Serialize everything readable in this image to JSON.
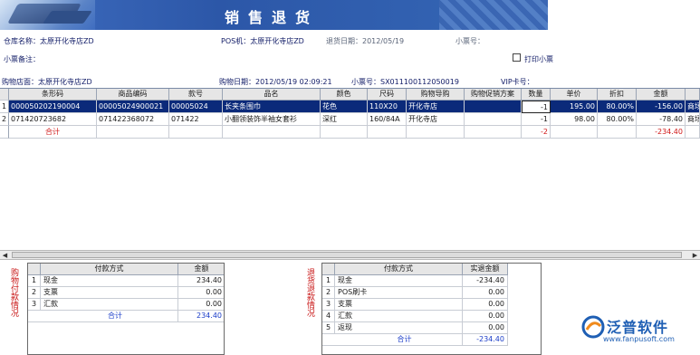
{
  "banner": {
    "title": "销售退货"
  },
  "info": {
    "warehouse": "仓库名称：太原开化寺店ZD",
    "pos": "POS机：太原开化寺店ZD",
    "return_date": "退货日期：2012/05/19",
    "receipt_no_label": "小票号：",
    "remark_label": "小票备注：",
    "print_receipt": "打印小票",
    "shop": "购物店面：太原开化寺店ZD",
    "purchase_date": "购物日期：2012/05/19 02:09:21",
    "receipt_no": "小票号：SX011100112050019",
    "vip_label": "VIP卡号："
  },
  "grid": {
    "columns": [
      "条形码",
      "商品编码",
      "款号",
      "品名",
      "颜色",
      "尺码",
      "购物导购",
      "购物促销方案",
      "数量",
      "单价",
      "折扣",
      "金额"
    ],
    "rows": [
      {
        "no": "1",
        "barcode": "000050202190004",
        "code": "00005024900021",
        "style": "00005024",
        "name": "长夹条围巾",
        "color": "花色",
        "size": "110X20",
        "guide": "开化寺店",
        "promo": "",
        "qty": "-1",
        "price": "195.00",
        "discount": "80.00%",
        "amount": "-156.00",
        "extra": "商场"
      },
      {
        "no": "2",
        "barcode": "071420723682",
        "code": "071422368072",
        "style": "071422",
        "name": "小翻领装饰半袖女套衫",
        "color": "深红",
        "size": "160/84A",
        "guide": "开化寺店",
        "promo": "",
        "qty": "-1",
        "price": "98.00",
        "discount": "80.00%",
        "amount": "-78.40",
        "extra": "商场"
      }
    ],
    "total_label": "合计",
    "total_qty": "-2",
    "total_amount": "-234.40"
  },
  "left_panel": {
    "side_label": "购物付款情况",
    "headers": [
      "付款方式",
      "金额"
    ],
    "rows": [
      {
        "no": "1",
        "method": "现金",
        "amount": "234.40"
      },
      {
        "no": "2",
        "method": "支票",
        "amount": "0.00"
      },
      {
        "no": "3",
        "method": "汇款",
        "amount": "0.00"
      }
    ],
    "total_label": "合计",
    "total_amount": "234.40"
  },
  "right_panel": {
    "side_label": "退货退款情况",
    "headers": [
      "付款方式",
      "实退金额"
    ],
    "rows": [
      {
        "no": "1",
        "method": "现金",
        "amount": "-234.40"
      },
      {
        "no": "2",
        "method": "POS刷卡",
        "amount": "0.00"
      },
      {
        "no": "3",
        "method": "支票",
        "amount": "0.00"
      },
      {
        "no": "4",
        "method": "汇款",
        "amount": "0.00"
      },
      {
        "no": "5",
        "method": "返现",
        "amount": "0.00"
      }
    ],
    "total_label": "合计",
    "total_amount": "-234.40"
  },
  "logo": {
    "name": "泛普软件",
    "url": "www.fanpusoft.com"
  },
  "colors": {
    "banner": "#2c57a8",
    "selected_row": "#0b2a7a",
    "total_red": "#d01818",
    "logo_blue": "#1f5fb4"
  }
}
